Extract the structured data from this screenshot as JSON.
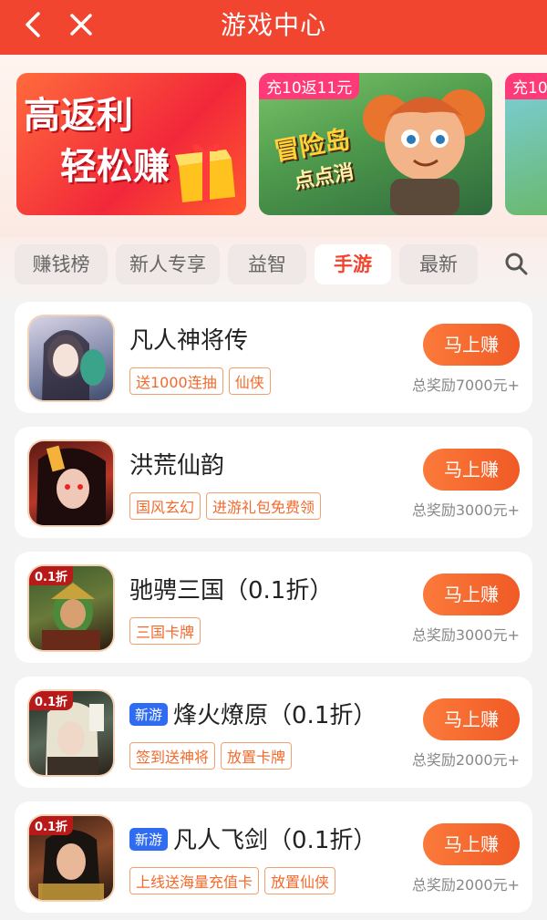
{
  "header": {
    "title": "游戏中心",
    "back_icon": "back-icon",
    "close_icon": "close-icon",
    "color": "#f2452f"
  },
  "banners": [
    {
      "slogan_line1": "高返利",
      "slogan_line2": "轻松赚"
    },
    {
      "promo": "充10返11元",
      "game_logo_line1": "冒险岛",
      "game_logo_line2": "点点消"
    },
    {
      "promo": "充10"
    }
  ],
  "tabs": [
    {
      "label": "赚钱榜",
      "active": false
    },
    {
      "label": "新人专享",
      "active": false
    },
    {
      "label": "益智",
      "active": false
    },
    {
      "label": "手游",
      "active": true
    },
    {
      "label": "最新",
      "active": false
    }
  ],
  "games": [
    {
      "name": "凡人神将传",
      "new": false,
      "badge": "",
      "tags": [
        "送1000连抽",
        "仙侠"
      ],
      "button": "马上赚",
      "reward": "总奖励7000元+"
    },
    {
      "name": "洪荒仙韵",
      "new": false,
      "badge": "",
      "tags": [
        "国风玄幻",
        "进游礼包免费领"
      ],
      "button": "马上赚",
      "reward": "总奖励3000元+"
    },
    {
      "name": "驰骋三国（0.1折）",
      "new": false,
      "badge": "0.1折",
      "tags": [
        "三国卡牌"
      ],
      "button": "马上赚",
      "reward": "总奖励3000元+"
    },
    {
      "name": "烽火燎原（0.1折）",
      "new": true,
      "new_label": "新游",
      "badge": "0.1折",
      "tags": [
        "签到送神将",
        "放置卡牌"
      ],
      "button": "马上赚",
      "reward": "总奖励2000元+"
    },
    {
      "name": "凡人飞剑（0.1折）",
      "new": true,
      "new_label": "新游",
      "badge": "0.1折",
      "tags": [
        "上线送海量充值卡",
        "放置仙侠"
      ],
      "button": "马上赚",
      "reward": "总奖励2000元+"
    }
  ]
}
